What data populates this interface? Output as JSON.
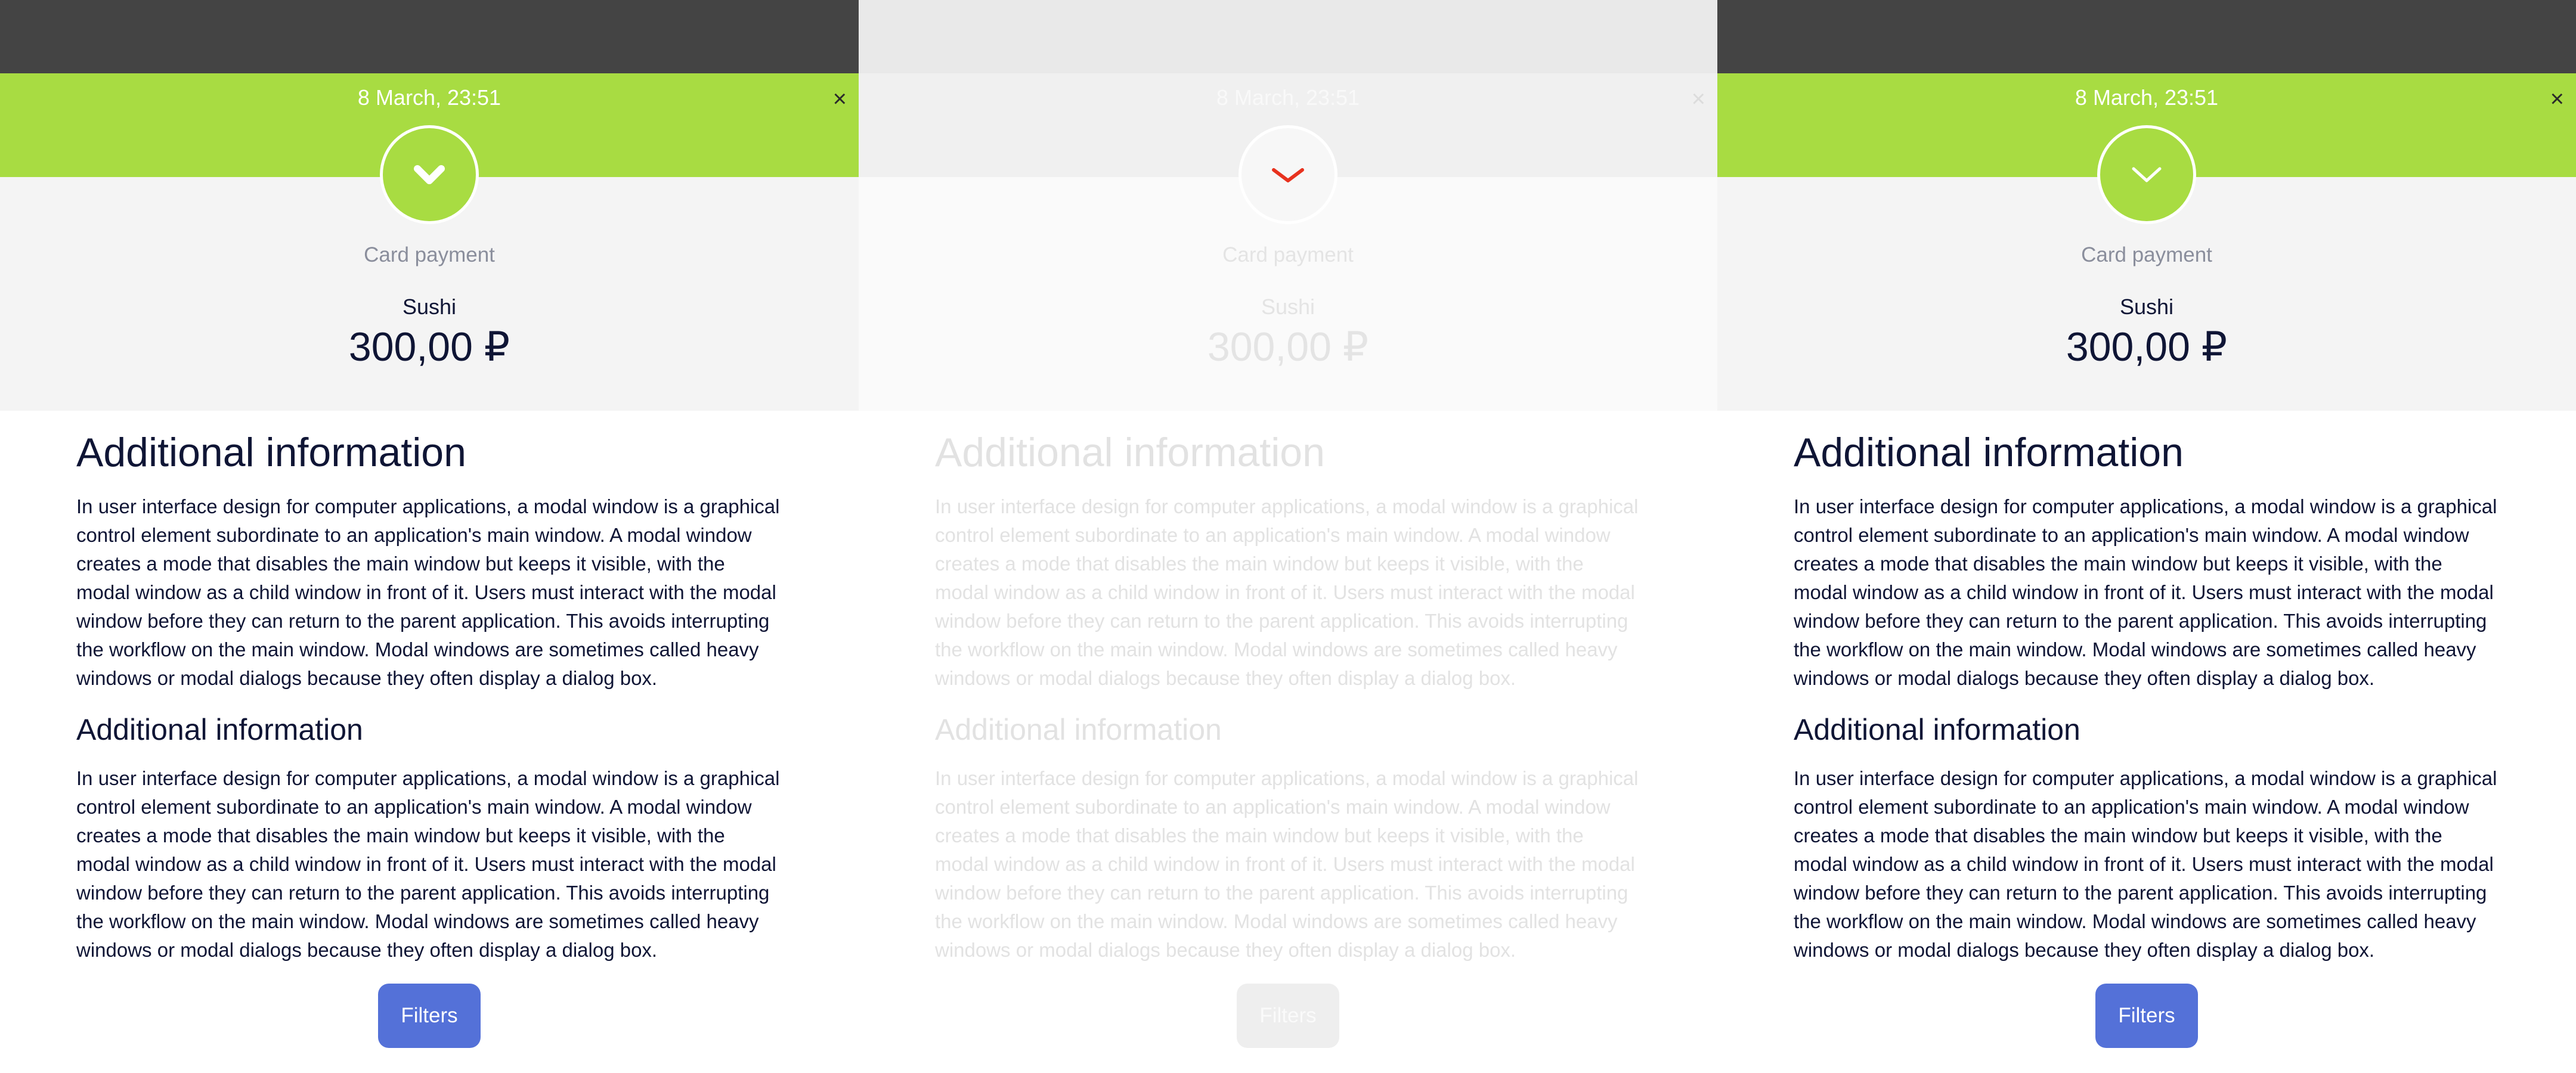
{
  "panels": [
    {
      "date": "8 March, 23:51",
      "close": "×",
      "method": "Card payment",
      "merchant": "Sushi",
      "amount": "300,00 ₽",
      "heading1": "Additional information",
      "paragraph1": "In user interface design for computer applications, a modal window is a graphical control element subordinate to an application's main window. A modal window creates a mode that disables the main window but keeps it visible, with the modal window as a child window in front of it. Users must interact with the modal window before they can return to the parent application. This avoids interrupting the workflow on the main window. Modal windows are sometimes called heavy windows or modal dialogs because they often display a dialog box.",
      "heading2": "Additional information",
      "paragraph2": "In user interface design for computer applications, a modal window is a graphical control element subordinate to an application's main window. A modal window creates a mode that disables the main window but keeps it visible, with the modal window as a child window in front of it. Users must interact with the modal window before they can return to the parent application. This avoids interrupting the workflow on the main window. Modal windows are sometimes called heavy windows or modal dialogs because they often display a dialog box.",
      "filters": "Filters",
      "icon": "chevron-down-icon",
      "icon_color": "#ffffff"
    },
    {
      "date": "8 March, 23:51",
      "close": "×",
      "method": "Card payment",
      "merchant": "Sushi",
      "amount": "300,00 ₽",
      "heading1": "Additional information",
      "paragraph1": "In user interface design for computer applications, a modal window is a graphical control element subordinate to an application's main window. A modal window creates a mode that disables the main window but keeps it visible, with the modal window as a child window in front of it. Users must interact with the modal window before they can return to the parent application. This avoids interrupting the workflow on the main window. Modal windows are sometimes called heavy windows or modal dialogs because they often display a dialog box.",
      "heading2": "Additional information",
      "paragraph2": "In user interface design for computer applications, a modal window is a graphical control element subordinate to an application's main window. A modal window creates a mode that disables the main window but keeps it visible, with the modal window as a child window in front of it. Users must interact with the modal window before they can return to the parent application. This avoids interrupting the workflow on the main window. Modal windows are sometimes called heavy windows or modal dialogs because they often display a dialog box.",
      "filters": "Filters",
      "icon": "chevron-down-icon",
      "icon_color": "#e8321e"
    },
    {
      "date": "8 March, 23:51",
      "close": "×",
      "method": "Card payment",
      "merchant": "Sushi",
      "amount": "300,00 ₽",
      "heading1": "Additional information",
      "paragraph1": "In user interface design for computer applications, a modal window is a graphical control element subordinate to an application's main window. A modal window creates a mode that disables the main window but keeps it visible, with the modal window as a child window in front of it. Users must interact with the modal window before they can return to the parent application. This avoids interrupting the workflow on the main window. Modal windows are sometimes called heavy windows or modal dialogs because they often display a dialog box.",
      "heading2": "Additional information",
      "paragraph2": "In user interface design for computer applications, a modal window is a graphical control element subordinate to an application's main window. A modal window creates a mode that disables the main window but keeps it visible, with the modal window as a child window in front of it. Users must interact with the modal window before they can return to the parent application. This avoids interrupting the workflow on the main window. Modal windows are sometimes called heavy windows or modal dialogs because they often display a dialog box.",
      "filters": "Filters",
      "icon": "chevron-down-icon",
      "icon_color": "#ffffff"
    }
  ]
}
